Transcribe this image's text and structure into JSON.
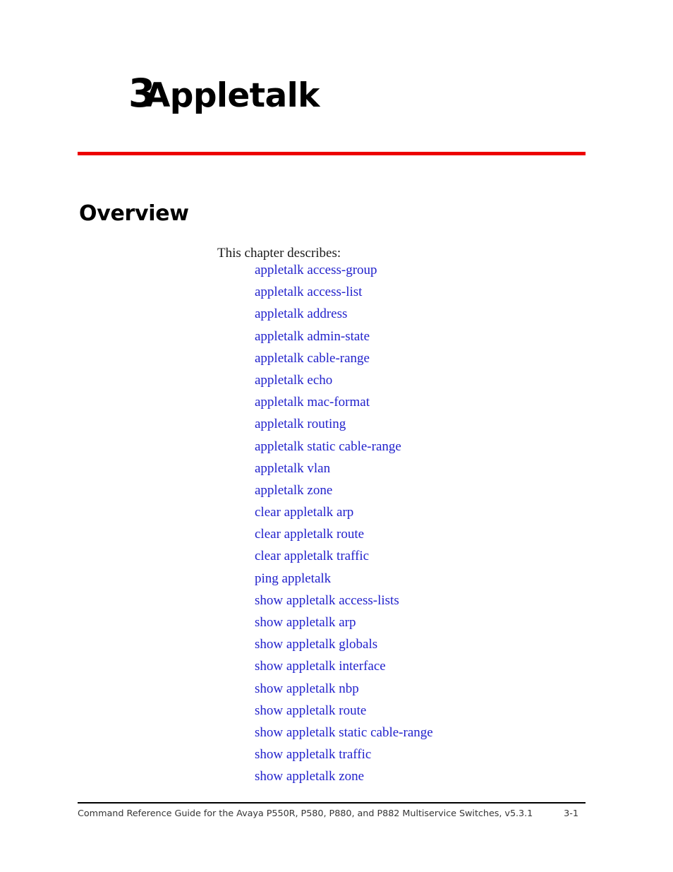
{
  "document": {
    "chapter_number": "3",
    "chapter_title": "Appletalk",
    "section_heading": "Overview",
    "intro_text": "This chapter describes:",
    "accent_rule_color": "#ED0000",
    "link_color": "#2222CC"
  },
  "links": [
    {
      "label": "appletalk access-group"
    },
    {
      "label": "appletalk access-list"
    },
    {
      "label": "appletalk address"
    },
    {
      "label": "appletalk admin-state"
    },
    {
      "label": "appletalk cable-range"
    },
    {
      "label": "appletalk echo"
    },
    {
      "label": "appletalk mac-format"
    },
    {
      "label": "appletalk routing"
    },
    {
      "label": "appletalk static cable-range"
    },
    {
      "label": "appletalk vlan"
    },
    {
      "label": "appletalk zone"
    },
    {
      "label": "clear appletalk arp"
    },
    {
      "label": "clear appletalk route"
    },
    {
      "label": "clear appletalk traffic"
    },
    {
      "label": "ping appletalk"
    },
    {
      "label": "show appletalk access-lists"
    },
    {
      "label": "show appletalk arp"
    },
    {
      "label": "show appletalk globals"
    },
    {
      "label": "show appletalk interface"
    },
    {
      "label": "show appletalk nbp"
    },
    {
      "label": "show appletalk route"
    },
    {
      "label": "show appletalk static cable-range"
    },
    {
      "label": "show appletalk traffic"
    },
    {
      "label": "show appletalk zone"
    }
  ],
  "footer": {
    "text": "Command Reference Guide for the Avaya P550R, P580, P880, and P882 Multiservice Switches, v5.3.1",
    "page_number": "3-1"
  }
}
